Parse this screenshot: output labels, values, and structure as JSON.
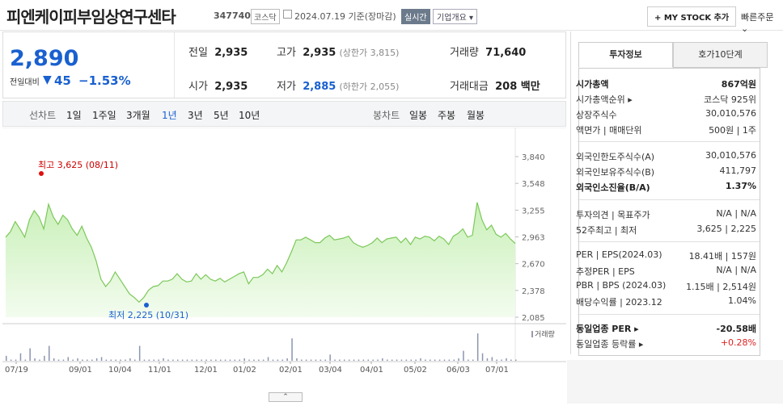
{
  "header": {
    "name": "피엔케이피부임상연구센타",
    "code": "347740",
    "market": "코스닥",
    "date": "2024.07.19 기준(장마감)",
    "live": "실시간",
    "corp_info": "기업개요 ▾",
    "mystock": "+ MY STOCK 추가",
    "fast_order": "빠른주문 ⌄"
  },
  "summary": {
    "price": "2,890",
    "vs_label": "전일대비",
    "arrow": "▼",
    "diff": "45",
    "pct": "−1.53%",
    "prev_label": "전일",
    "prev": "2,935",
    "high_label": "고가",
    "high": "2,935",
    "upper_limit": "(상한가 3,815)",
    "volume_label": "거래량",
    "volume": "71,640",
    "open_label": "시가",
    "open": "2,935",
    "low_label": "저가",
    "low": "2,885",
    "lower_limit": "(하한가 2,055)",
    "amount_label": "거래대금",
    "amount": "208 백만"
  },
  "chart_tabs": {
    "line_label": "선차트",
    "periods": [
      "1일",
      "1주일",
      "3개월",
      "1년",
      "3년",
      "5년",
      "10년"
    ],
    "selected": "1년",
    "candle_label": "봉차트",
    "candles": [
      "일봉",
      "주봉",
      "월봉"
    ]
  },
  "chart_data": {
    "type": "area",
    "y_ticks": [
      "3,840",
      "3,548",
      "3,255",
      "2,963",
      "2,670",
      "2,378",
      "2,085"
    ],
    "ylim": [
      2085,
      3840
    ],
    "x_ticks": [
      "07/19",
      "09/01",
      "10/04",
      "11/01",
      "12/01",
      "01/02",
      "02/01",
      "03/04",
      "04/01",
      "05/02",
      "06/03",
      "07/01"
    ],
    "high_label": "최고 3,625 (08/11)",
    "low_label": "최저 2,225 (10/31)",
    "volume_label": "거래량",
    "series": [
      {
        "values": [
          2960,
          3020,
          3130,
          3050,
          2960,
          3150,
          3250,
          3180,
          3050,
          3320,
          3180,
          3100,
          3200,
          3150,
          3050,
          2980,
          3080,
          2950,
          2850,
          2700,
          2500,
          2420,
          2480,
          2580,
          2500,
          2420,
          2340,
          2300,
          2250,
          2300,
          2380,
          2420,
          2430,
          2480,
          2480,
          2500,
          2560,
          2500,
          2470,
          2480,
          2560,
          2500,
          2550,
          2500,
          2480,
          2510,
          2470,
          2500,
          2530,
          2560,
          2580,
          2450,
          2520,
          2520,
          2550,
          2610,
          2560,
          2650,
          2580,
          2680,
          2800,
          2930,
          2930,
          2960,
          2930,
          2900,
          2900,
          2950,
          2980,
          2930,
          2940,
          2950,
          2970,
          2900,
          2870,
          2850,
          2870,
          2900,
          2950,
          2900,
          2940,
          2950,
          2960,
          2900,
          2950,
          2880,
          2960,
          2940,
          2970,
          2960,
          2920,
          2970,
          2940,
          2880,
          2970,
          3000,
          3050,
          2960,
          2980,
          3340,
          3150,
          3040,
          3090,
          2990,
          2960,
          3000,
          2940,
          2890
        ]
      }
    ],
    "volume": [
      4,
      1,
      1,
      6,
      1,
      10,
      2,
      1,
      4,
      12,
      2,
      1,
      1,
      3,
      1,
      2,
      1,
      1,
      1,
      2,
      3,
      1,
      1,
      1,
      1,
      1,
      2,
      1,
      12,
      1,
      1,
      1,
      1,
      2,
      1,
      1,
      1,
      1,
      1,
      1,
      1,
      1,
      1,
      1,
      1,
      1,
      1,
      1,
      1,
      1,
      2,
      1,
      1,
      1,
      1,
      3,
      1,
      1,
      1,
      2,
      18,
      2,
      1,
      1,
      1,
      1,
      1,
      1,
      5,
      1,
      1,
      1,
      1,
      1,
      1,
      1,
      1,
      1,
      1,
      2,
      1,
      1,
      1,
      1,
      1,
      1,
      1,
      2,
      1,
      1,
      1,
      1,
      1,
      1,
      1,
      2,
      8,
      1,
      1,
      22,
      6,
      2,
      3,
      1,
      1,
      2,
      1,
      1
    ]
  },
  "panel": {
    "tab_info": "투자정보",
    "tab_orderbook": "호가10단계",
    "rows": [
      {
        "k": "시가총액",
        "v": "867억원"
      },
      {
        "k": "시가총액순위 ▸",
        "v": "코스닥 925위"
      },
      {
        "k": "상장주식수",
        "v": "30,010,576"
      },
      {
        "k": "액면가 | 매매단위",
        "v": "500원 | 1주"
      },
      {
        "k": "외국인한도주식수(A)",
        "v": "30,010,576"
      },
      {
        "k": "외국인보유주식수(B)",
        "v": "411,797"
      },
      {
        "k": "외국인소진율(B/A)",
        "v": "1.37%"
      },
      {
        "k": "투자의견 | 목표주가",
        "v": "N/A | N/A"
      },
      {
        "k": "52주최고 | 최저",
        "v": "3,625 | 2,225"
      },
      {
        "k": "PER | EPS(2024.03)",
        "v": "18.41배 | 157원"
      },
      {
        "k": "추정PER | EPS",
        "v": "N/A | N/A"
      },
      {
        "k": "PBR | BPS (2024.03)",
        "v": "1.15배 | 2,514원"
      },
      {
        "k": "배당수익률 | 2023.12",
        "v": "1.04%"
      },
      {
        "k": "동일업종 PER ▸",
        "v": "-20.58배"
      },
      {
        "k": "동일업종 등락률 ▸",
        "v": "+0.28%"
      }
    ]
  },
  "collapse": "⌃"
}
